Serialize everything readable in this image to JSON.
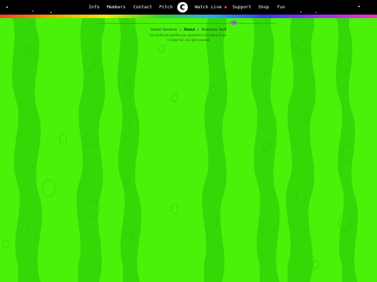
{
  "nav": {
    "items": [
      {
        "label": "Info"
      },
      {
        "label": "Members"
      },
      {
        "label": "Contact"
      },
      {
        "label": "Pitch"
      },
      {
        "label": "Watch Live"
      },
      {
        "label": "Support"
      },
      {
        "label": "Shop"
      },
      {
        "label": "Fun"
      }
    ],
    "live_indicator": "●"
  },
  "footer": {
    "links": [
      {
        "label": "Guest Services"
      },
      {
        "label": "About"
      },
      {
        "label": "Business Stuff"
      }
    ],
    "separator": "|",
    "terms": "Use of this site signifies your agreement to the terms of use.",
    "copyright": "© Cable Two. No rights reserved"
  },
  "colors": {
    "background": "#4af20a",
    "stripe": "#2fd606",
    "topbar": "#000000"
  }
}
